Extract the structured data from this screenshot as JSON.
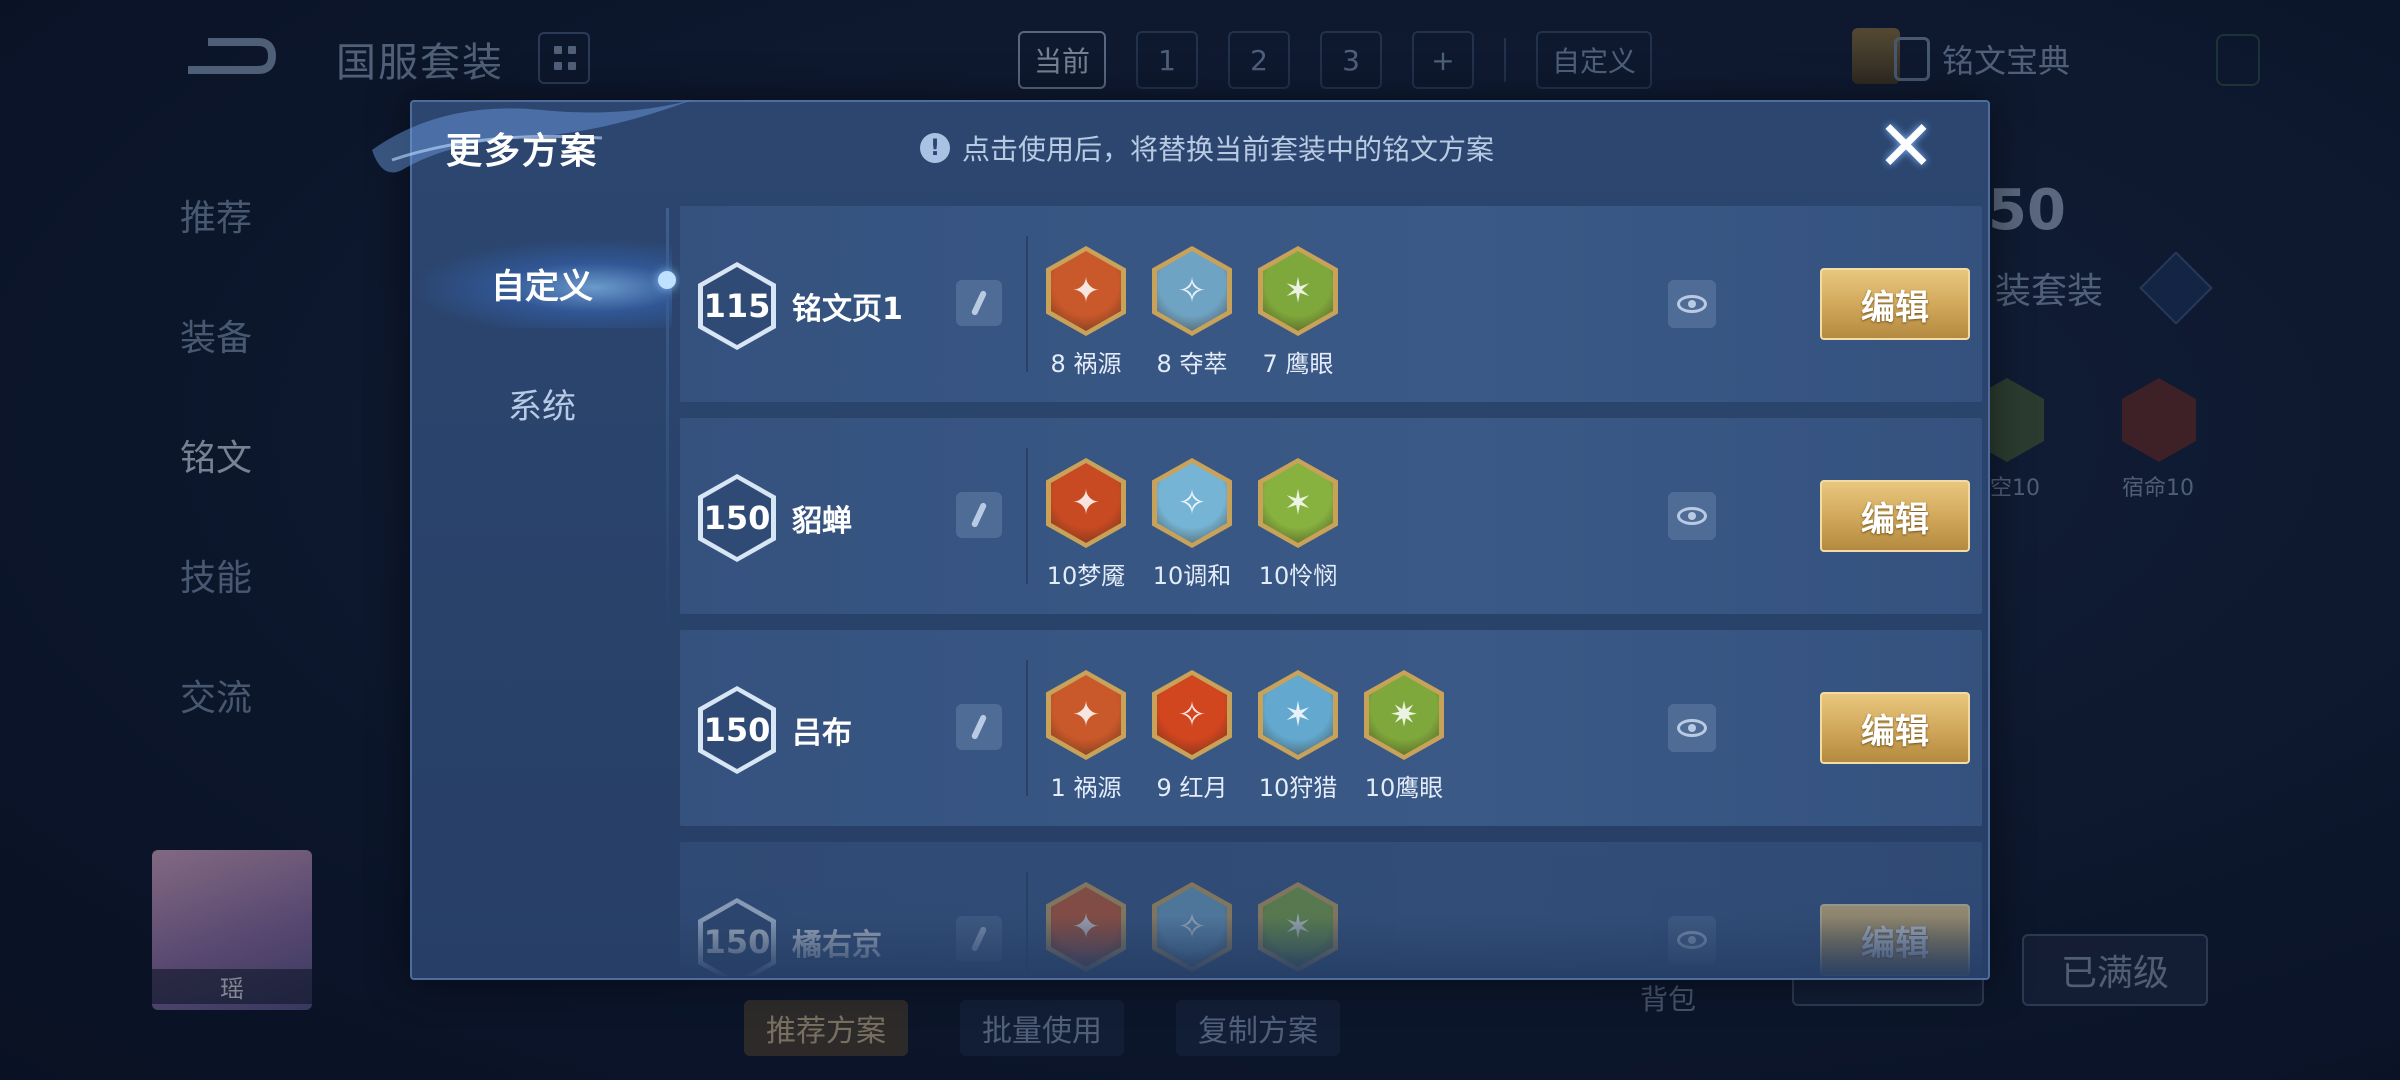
{
  "background": {
    "title": "国服套装",
    "top_tabs": [
      "当前",
      "1",
      "2",
      "3",
      "+"
    ],
    "custom_tab": "自定义",
    "codex_label": "铭文宝典",
    "left_nav": [
      "推荐",
      "装备",
      "铭文",
      "技能",
      "交流"
    ],
    "hero_name": "瑶",
    "right_level": "50",
    "right_suit_label": "装套装",
    "bg_rune_labels": [
      "空10",
      "宿命10"
    ],
    "bottom_buttons": [
      "推荐方案",
      "批量使用",
      "复制方案"
    ],
    "bag_label": "背包",
    "maxed_label": "已满级"
  },
  "modal": {
    "title": "更多方案",
    "hint": "点击使用后，将替换当前套装中的铭文方案",
    "close_symbol": "✕",
    "tabs": [
      {
        "label": "自定义",
        "active": true
      },
      {
        "label": "系统",
        "active": false
      }
    ],
    "edit_label": "编辑",
    "pages": [
      {
        "level": "115",
        "name": "铭文页1",
        "runes": [
          {
            "count": "8",
            "name": "祸源",
            "color": "#c9582a"
          },
          {
            "count": "8",
            "name": "夺萃",
            "color": "#6fa3c4"
          },
          {
            "count": "7",
            "name": "鹰眼",
            "color": "#7fa83c"
          }
        ]
      },
      {
        "level": "150",
        "name": "貂蝉",
        "runes": [
          {
            "count": "10",
            "name": "梦魇",
            "color": "#c84a22"
          },
          {
            "count": "10",
            "name": "调和",
            "color": "#76b4d6"
          },
          {
            "count": "10",
            "name": "怜悯",
            "color": "#87b240"
          }
        ]
      },
      {
        "level": "150",
        "name": "吕布",
        "runes": [
          {
            "count": "1",
            "name": "祸源",
            "color": "#c9582a"
          },
          {
            "count": "9",
            "name": "红月",
            "color": "#d1451f"
          },
          {
            "count": "10",
            "name": "狩猎",
            "color": "#62a8cf"
          },
          {
            "count": "10",
            "name": "鹰眼",
            "color": "#7fa83c"
          }
        ]
      },
      {
        "level": "150",
        "name": "橘右京",
        "runes": [
          {
            "count": "",
            "name": "",
            "color": "#c9582a"
          },
          {
            "count": "",
            "name": "",
            "color": "#6fa3c4"
          },
          {
            "count": "",
            "name": "",
            "color": "#7fa83c"
          }
        ]
      }
    ]
  }
}
